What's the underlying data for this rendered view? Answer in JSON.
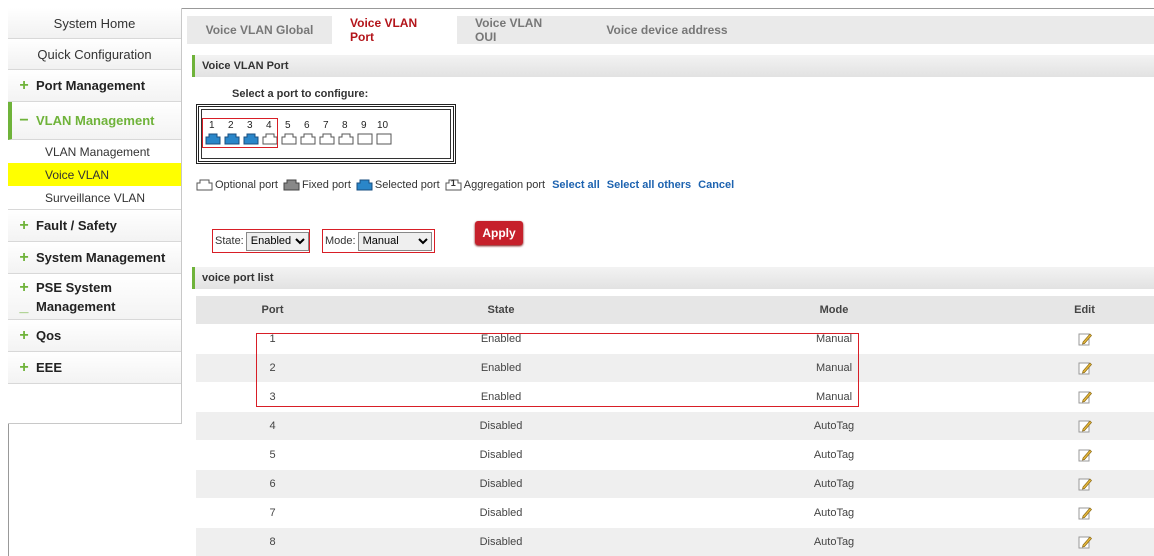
{
  "sidebar": {
    "home": "System Home",
    "quick": "Quick Configuration",
    "items": [
      {
        "label": "Port Management",
        "sign": "+"
      },
      {
        "label": "VLAN Management",
        "sign": "−"
      },
      {
        "label": "Fault / Safety",
        "sign": "+"
      },
      {
        "label": "System Management",
        "sign": "+"
      },
      {
        "label_line1": "PSE System",
        "label_line2": "Management",
        "sign1": "+",
        "sign2": "_"
      },
      {
        "label": "Qos",
        "sign": "+"
      },
      {
        "label": "EEE",
        "sign": "+"
      }
    ],
    "vlan_sub": [
      "VLAN Management",
      "Voice VLAN",
      "Surveillance VLAN"
    ]
  },
  "tabs": [
    "Voice VLAN Global",
    "Voice VLAN Port",
    "Voice VLAN OUI",
    "Voice device address"
  ],
  "active_tab": "Voice VLAN Port",
  "section_port": "Voice VLAN Port",
  "select_prompt": "Select a port to configure:",
  "ports": [
    "1",
    "2",
    "3",
    "4",
    "5",
    "6",
    "7",
    "8",
    "9",
    "10"
  ],
  "selected_ports": [
    "1",
    "2",
    "3"
  ],
  "legend": {
    "optional": "Optional port",
    "fixed": "Fixed port",
    "selected": "Selected port",
    "aggregation_num": "1",
    "aggregation": "Aggregation port",
    "select_all": "Select all",
    "select_others": "Select all others",
    "cancel": "Cancel"
  },
  "state_label": "State:",
  "state_value": "Enabled",
  "mode_label": "Mode:",
  "mode_value": "Manual",
  "apply_label": "Apply",
  "section_list": "voice port list",
  "table": {
    "headers": [
      "Port",
      "State",
      "Mode",
      "Edit"
    ],
    "rows": [
      [
        "1",
        "Enabled",
        "Manual"
      ],
      [
        "2",
        "Enabled",
        "Manual"
      ],
      [
        "3",
        "Enabled",
        "Manual"
      ],
      [
        "4",
        "Disabled",
        "AutoTag"
      ],
      [
        "5",
        "Disabled",
        "AutoTag"
      ],
      [
        "6",
        "Disabled",
        "AutoTag"
      ],
      [
        "7",
        "Disabled",
        "AutoTag"
      ],
      [
        "8",
        "Disabled",
        "AutoTag"
      ]
    ]
  },
  "colors": {
    "accent_green": "#6fb33a",
    "active_tab_red": "#b3141a",
    "highlight_yellow": "#ffff00",
    "apply_red": "#c6202b",
    "link_blue": "#1d63b0"
  }
}
